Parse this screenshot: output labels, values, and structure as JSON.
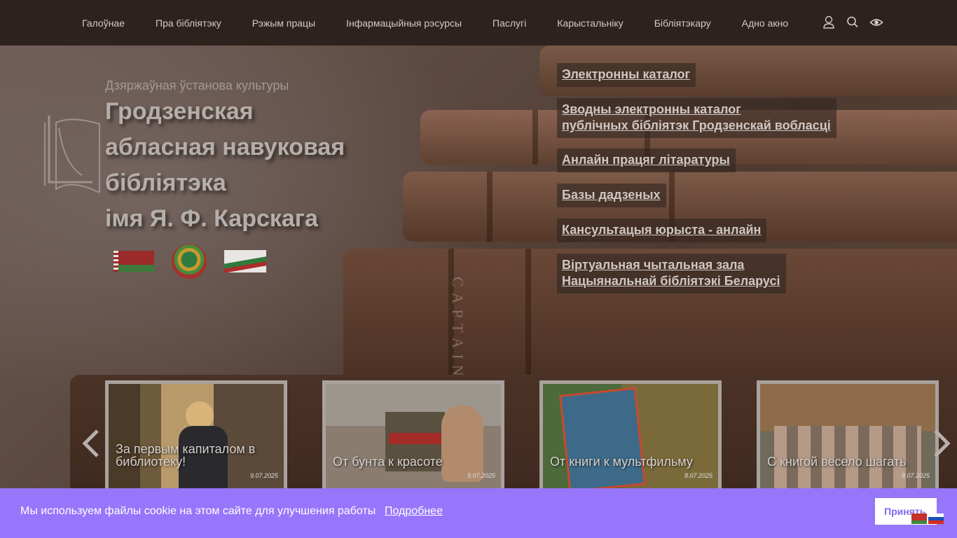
{
  "nav": {
    "items": [
      "Галоўнае",
      "Пра бібліятэку",
      "Рэжым працы",
      "Інфармацыйныя рэсурсы",
      "Паслугі",
      "Карыстальніку",
      "Бібліятэкару",
      "Адно акно"
    ],
    "icons": [
      "user-icon",
      "search-icon",
      "eye-icon"
    ]
  },
  "hero": {
    "subtitle": "Дзяржаўная ўстанова культуры",
    "title_lines": [
      "Гродзенская",
      "абласная навуковая",
      "бібліятэка",
      "імя Я. Ф. Карскага"
    ],
    "book_spine_text": "CAPTAIN COOK"
  },
  "links": [
    "Электронны каталог",
    "Зводны электронны каталог",
    "публічных бібліятэк Гродзенскай вобласці",
    "Анлайн працяг літаратуры",
    "Базы дадзеных",
    "Кансультацыя юрыста - анлайн",
    "Віртуальная чытальная зала",
    "Нацыянальнай бібліятэкі Беларусі"
  ],
  "carousel": [
    {
      "caption": "За первым капиталом в библиотеку!",
      "date": "9.07.2025"
    },
    {
      "caption": "От бунта к красоте",
      "date": "9.07.2025"
    },
    {
      "caption": "От книги к мультфильму",
      "date": "8.07.2025"
    },
    {
      "caption": "С книгой весело шагать",
      "date": "8.07.2025"
    }
  ],
  "cookie": {
    "message": "Мы используем файлы cookie на этом сайте для улучшения работы",
    "more_link": "Подробнее",
    "accept_label": "Принять"
  },
  "colors": {
    "topbar": "#2d221e",
    "cookie_bar": "#9776fb",
    "accept_text": "#8467f0"
  }
}
